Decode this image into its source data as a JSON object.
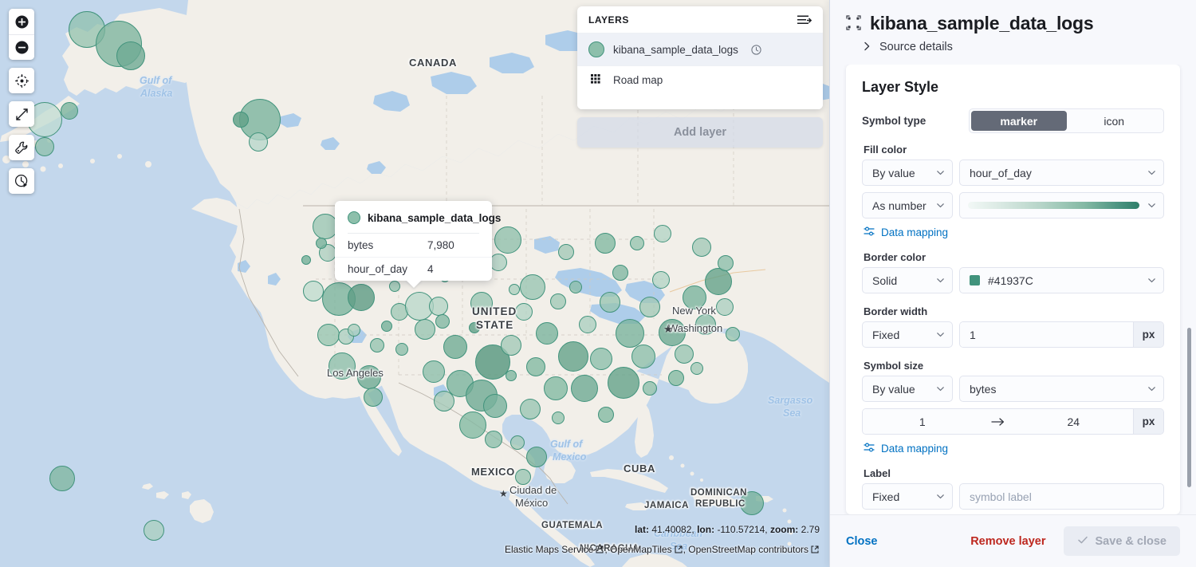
{
  "map": {
    "toolbar": [
      {
        "name": "zoom-in-icon",
        "title": "Zoom in"
      },
      {
        "name": "zoom-out-icon",
        "title": "Zoom out"
      },
      {
        "name": "locate-icon",
        "title": "Fit to data bounds"
      },
      {
        "name": "expand-icon",
        "title": "Fullscreen"
      },
      {
        "name": "tools-icon",
        "title": "Tools"
      },
      {
        "name": "timeslider-icon",
        "title": "Timeslider"
      }
    ],
    "labels": {
      "canada": "CANADA",
      "united": "UNITED",
      "states": "STATE",
      "mexico": "MEXICO",
      "cuba": "CUBA",
      "jamaica": "JAMAICA",
      "dominican1": "DOMINICAN",
      "dominican2": "REPUBLIC",
      "guatemala": "GUATEMALA",
      "nicaragua": "NICARAGUA",
      "new_york": "New York",
      "washington": "Washington",
      "los_angeles": "Los Angeles",
      "ciudad1": "Ciudad de",
      "ciudad2": "México",
      "gulf_alaska1": "Gulf of",
      "gulf_alaska2": "Alaska",
      "gulf_mexico1": "Gulf of",
      "gulf_mexico2": "Mexico",
      "sargasso1": "Sargasso",
      "sargasso2": "Sea",
      "caribbean1": "Caribbean",
      "caribbean2": "Sea"
    },
    "coords": {
      "lat_key": "lat:",
      "lat_val": "41.40082",
      "lon_key": "lon:",
      "lon_val": "-110.57214",
      "zoom_key": "zoom:",
      "zoom_val": "2.79",
      "full": "lat: 41.40082, lon: -110.57214, zoom: 2.79"
    },
    "attribution": [
      {
        "text": "Elastic Maps Service",
        "external": true
      },
      {
        "text": "OpenMapTiles",
        "external": true
      },
      {
        "text": "OpenStreetMap contributors",
        "external": true
      }
    ],
    "colors": {
      "water": "#c3d7ec",
      "land": "#f2efe9",
      "marker_border": "#41937c",
      "marker_fill": "#8dbfab"
    }
  },
  "layers_panel": {
    "title": "LAYERS",
    "list_icon": "layer-order-icon",
    "items": [
      {
        "label": "kibana_sample_data_logs",
        "icon": "layer-symbol-circle-icon",
        "badge": "clock-icon",
        "selected": true
      },
      {
        "label": "Road map",
        "icon": "grid-basemap-icon",
        "badge": "",
        "selected": false
      }
    ],
    "add_layer_label": "Add layer"
  },
  "tooltip": {
    "title": "kibana_sample_data_logs",
    "rows": [
      {
        "key": "bytes",
        "value": "7,980"
      },
      {
        "key": "hour_of_day",
        "value": "4"
      }
    ]
  },
  "flyout": {
    "title": "kibana_sample_data_logs",
    "title_icon": "vector-layer-icon",
    "source_details": {
      "label": "Source details",
      "icon": "chevron-right-icon",
      "expanded": false
    },
    "layer_style": {
      "card_title": "Layer Style",
      "symbol_type": {
        "label": "Symbol type",
        "options": [
          "marker",
          "icon"
        ],
        "selected": "marker"
      },
      "fill_color": {
        "label": "Fill color",
        "mode": "By value",
        "field": "hour_of_day",
        "number_mode": "As number",
        "ramp_name": "green-gradient",
        "ramp_stops": [
          "#f2f8f6",
          "#dbeae4",
          "#b7d5c9",
          "#84b9a4",
          "#4b9480",
          "#2e7f69"
        ],
        "data_mapping_label": "Data mapping"
      },
      "border_color": {
        "label": "Border color",
        "mode": "Solid",
        "value": "#41937C",
        "swatch": "#41937C"
      },
      "border_width": {
        "label": "Border width",
        "mode": "Fixed",
        "value": "1",
        "unit": "px"
      },
      "symbol_size": {
        "label": "Symbol size",
        "mode": "By value",
        "field": "bytes",
        "min": "1",
        "max": "24",
        "unit": "px",
        "data_mapping_label": "Data mapping"
      },
      "label_section": {
        "label": "Label",
        "mode": "Fixed",
        "placeholder": "symbol label",
        "value": ""
      }
    },
    "footer": {
      "close": "Close",
      "remove": "Remove layer",
      "save": "Save & close",
      "save_icon": "check-icon",
      "save_disabled": true
    },
    "accent_blue": "#0071c2",
    "danger_red": "#bd271e"
  }
}
